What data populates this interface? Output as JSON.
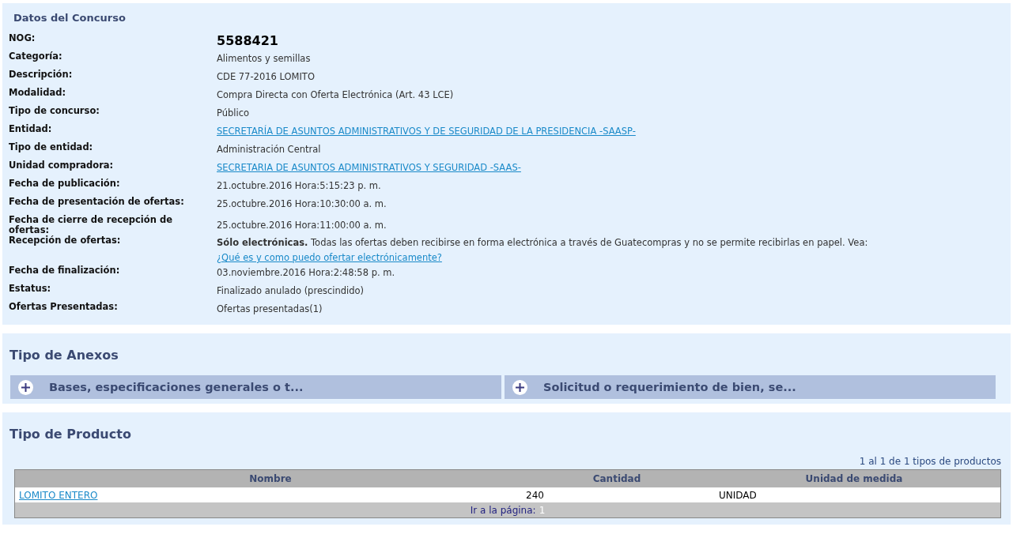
{
  "datos": {
    "title": "Datos del Concurso",
    "fields": [
      {
        "label": "NOG:",
        "value": "5588421",
        "kind": "big"
      },
      {
        "label": "Categoría:",
        "value": "Alimentos y semillas",
        "kind": "text"
      },
      {
        "label": "Descripción:",
        "value": "CDE 77-2016 LOMITO",
        "kind": "text"
      },
      {
        "label": "Modalidad:",
        "value": "Compra Directa con Oferta Electrónica (Art. 43 LCE)",
        "kind": "text"
      },
      {
        "label": "Tipo de concurso:",
        "value": "Público",
        "kind": "text"
      },
      {
        "label": "Entidad:",
        "value": "SECRETARÍA DE ASUNTOS ADMINISTRATIVOS Y DE SEGURIDAD DE LA PRESIDENCIA -SAASP-",
        "kind": "link"
      },
      {
        "label": "Tipo de entidad:",
        "value": "Administración Central",
        "kind": "text"
      },
      {
        "label": "Unidad compradora:",
        "value": "SECRETARIA DE ASUNTOS ADMINISTRATIVOS Y SEGURIDAD -SAAS-",
        "kind": "link"
      },
      {
        "label": "Fecha de publicación:",
        "value": "21.octubre.2016 Hora:5:15:23 p. m.",
        "kind": "text"
      },
      {
        "label": "Fecha de presentación de ofertas:",
        "value": "25.octubre.2016 Hora:10:30:00 a. m.",
        "kind": "text"
      },
      {
        "label": "Fecha de cierre de recepción de ofertas:",
        "value": "25.octubre.2016 Hora:11:00:00 a. m.",
        "kind": "text"
      },
      {
        "label": "Recepción de ofertas:",
        "value": "**Sólo electrónicas.** Todas las ofertas deben recibirse en forma electrónica a través de Guatecompras y no se permite recibirlas en papel. Vea:",
        "link": "¿Qué es y como puedo ofertar electrónicamente?",
        "kind": "rich"
      },
      {
        "label": "Fecha de finalización:",
        "value": "03.noviembre.2016 Hora:2:48:58 p. m.",
        "kind": "text"
      },
      {
        "label": "Estatus:",
        "value": "Finalizado anulado (prescindido)",
        "kind": "text"
      },
      {
        "label": "Ofertas Presentadas:",
        "value": "Ofertas presentadas(1)",
        "kind": "text"
      }
    ]
  },
  "anexos": {
    "title": "Tipo de Anexos",
    "items": [
      {
        "label": "Bases, especificaciones generales o t...",
        "expanded": false
      },
      {
        "label": "Solicitud o requerimiento de bien, se...",
        "expanded": false
      }
    ]
  },
  "producto": {
    "title": "Tipo de Producto",
    "summary": "1 al 1 de 1 tipos de productos",
    "table": {
      "columns": [
        "Nombre",
        "Cantidad",
        "Unidad de medida"
      ],
      "rows": [
        {
          "nombre": "LOMITO ENTERO",
          "cantidad": "240",
          "unidad": "UNIDAD"
        }
      ]
    },
    "pager": {
      "label": "Ir a la página:",
      "pages": [
        "1"
      ]
    }
  }
}
